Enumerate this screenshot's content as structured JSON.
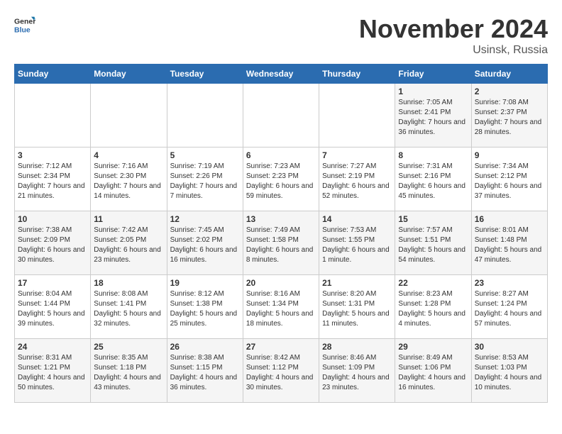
{
  "header": {
    "logo_general": "General",
    "logo_blue": "Blue",
    "title": "November 2024",
    "subtitle": "Usinsk, Russia"
  },
  "weekdays": [
    "Sunday",
    "Monday",
    "Tuesday",
    "Wednesday",
    "Thursday",
    "Friday",
    "Saturday"
  ],
  "weeks": [
    [
      null,
      null,
      null,
      null,
      null,
      {
        "day": "1",
        "sunrise": "Sunrise: 7:05 AM",
        "sunset": "Sunset: 2:41 PM",
        "daylight": "Daylight: 7 hours and 36 minutes."
      },
      {
        "day": "2",
        "sunrise": "Sunrise: 7:08 AM",
        "sunset": "Sunset: 2:37 PM",
        "daylight": "Daylight: 7 hours and 28 minutes."
      }
    ],
    [
      {
        "day": "3",
        "sunrise": "Sunrise: 7:12 AM",
        "sunset": "Sunset: 2:34 PM",
        "daylight": "Daylight: 7 hours and 21 minutes."
      },
      {
        "day": "4",
        "sunrise": "Sunrise: 7:16 AM",
        "sunset": "Sunset: 2:30 PM",
        "daylight": "Daylight: 7 hours and 14 minutes."
      },
      {
        "day": "5",
        "sunrise": "Sunrise: 7:19 AM",
        "sunset": "Sunset: 2:26 PM",
        "daylight": "Daylight: 7 hours and 7 minutes."
      },
      {
        "day": "6",
        "sunrise": "Sunrise: 7:23 AM",
        "sunset": "Sunset: 2:23 PM",
        "daylight": "Daylight: 6 hours and 59 minutes."
      },
      {
        "day": "7",
        "sunrise": "Sunrise: 7:27 AM",
        "sunset": "Sunset: 2:19 PM",
        "daylight": "Daylight: 6 hours and 52 minutes."
      },
      {
        "day": "8",
        "sunrise": "Sunrise: 7:31 AM",
        "sunset": "Sunset: 2:16 PM",
        "daylight": "Daylight: 6 hours and 45 minutes."
      },
      {
        "day": "9",
        "sunrise": "Sunrise: 7:34 AM",
        "sunset": "Sunset: 2:12 PM",
        "daylight": "Daylight: 6 hours and 37 minutes."
      }
    ],
    [
      {
        "day": "10",
        "sunrise": "Sunrise: 7:38 AM",
        "sunset": "Sunset: 2:09 PM",
        "daylight": "Daylight: 6 hours and 30 minutes."
      },
      {
        "day": "11",
        "sunrise": "Sunrise: 7:42 AM",
        "sunset": "Sunset: 2:05 PM",
        "daylight": "Daylight: 6 hours and 23 minutes."
      },
      {
        "day": "12",
        "sunrise": "Sunrise: 7:45 AM",
        "sunset": "Sunset: 2:02 PM",
        "daylight": "Daylight: 6 hours and 16 minutes."
      },
      {
        "day": "13",
        "sunrise": "Sunrise: 7:49 AM",
        "sunset": "Sunset: 1:58 PM",
        "daylight": "Daylight: 6 hours and 8 minutes."
      },
      {
        "day": "14",
        "sunrise": "Sunrise: 7:53 AM",
        "sunset": "Sunset: 1:55 PM",
        "daylight": "Daylight: 6 hours and 1 minute."
      },
      {
        "day": "15",
        "sunrise": "Sunrise: 7:57 AM",
        "sunset": "Sunset: 1:51 PM",
        "daylight": "Daylight: 5 hours and 54 minutes."
      },
      {
        "day": "16",
        "sunrise": "Sunrise: 8:01 AM",
        "sunset": "Sunset: 1:48 PM",
        "daylight": "Daylight: 5 hours and 47 minutes."
      }
    ],
    [
      {
        "day": "17",
        "sunrise": "Sunrise: 8:04 AM",
        "sunset": "Sunset: 1:44 PM",
        "daylight": "Daylight: 5 hours and 39 minutes."
      },
      {
        "day": "18",
        "sunrise": "Sunrise: 8:08 AM",
        "sunset": "Sunset: 1:41 PM",
        "daylight": "Daylight: 5 hours and 32 minutes."
      },
      {
        "day": "19",
        "sunrise": "Sunrise: 8:12 AM",
        "sunset": "Sunset: 1:38 PM",
        "daylight": "Daylight: 5 hours and 25 minutes."
      },
      {
        "day": "20",
        "sunrise": "Sunrise: 8:16 AM",
        "sunset": "Sunset: 1:34 PM",
        "daylight": "Daylight: 5 hours and 18 minutes."
      },
      {
        "day": "21",
        "sunrise": "Sunrise: 8:20 AM",
        "sunset": "Sunset: 1:31 PM",
        "daylight": "Daylight: 5 hours and 11 minutes."
      },
      {
        "day": "22",
        "sunrise": "Sunrise: 8:23 AM",
        "sunset": "Sunset: 1:28 PM",
        "daylight": "Daylight: 5 hours and 4 minutes."
      },
      {
        "day": "23",
        "sunrise": "Sunrise: 8:27 AM",
        "sunset": "Sunset: 1:24 PM",
        "daylight": "Daylight: 4 hours and 57 minutes."
      }
    ],
    [
      {
        "day": "24",
        "sunrise": "Sunrise: 8:31 AM",
        "sunset": "Sunset: 1:21 PM",
        "daylight": "Daylight: 4 hours and 50 minutes."
      },
      {
        "day": "25",
        "sunrise": "Sunrise: 8:35 AM",
        "sunset": "Sunset: 1:18 PM",
        "daylight": "Daylight: 4 hours and 43 minutes."
      },
      {
        "day": "26",
        "sunrise": "Sunrise: 8:38 AM",
        "sunset": "Sunset: 1:15 PM",
        "daylight": "Daylight: 4 hours and 36 minutes."
      },
      {
        "day": "27",
        "sunrise": "Sunrise: 8:42 AM",
        "sunset": "Sunset: 1:12 PM",
        "daylight": "Daylight: 4 hours and 30 minutes."
      },
      {
        "day": "28",
        "sunrise": "Sunrise: 8:46 AM",
        "sunset": "Sunset: 1:09 PM",
        "daylight": "Daylight: 4 hours and 23 minutes."
      },
      {
        "day": "29",
        "sunrise": "Sunrise: 8:49 AM",
        "sunset": "Sunset: 1:06 PM",
        "daylight": "Daylight: 4 hours and 16 minutes."
      },
      {
        "day": "30",
        "sunrise": "Sunrise: 8:53 AM",
        "sunset": "Sunset: 1:03 PM",
        "daylight": "Daylight: 4 hours and 10 minutes."
      }
    ]
  ]
}
